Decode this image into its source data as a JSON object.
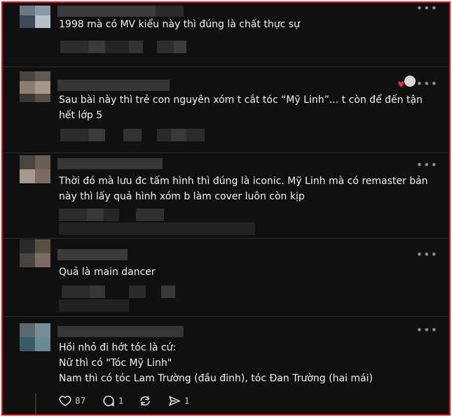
{
  "posts": [
    {
      "text": "1998 mà có MV kiểu này thì đúng là chất thực sự"
    },
    {
      "text": "Sau bài này thì trẻ con nguyên xóm t cắt tóc “Mỹ Linh”... t còn để đến tận hết lớp 5"
    },
    {
      "text": "Thời đó mà lưu đc tấm hình thì đúng là iconic. Mỹ Linh mà có remaster bản này thì lấy quả hình xóm b làm cover luôn còn kịp"
    },
    {
      "text": "Quả là main dancer"
    },
    {
      "lines": [
        "Hồi nhỏ đi hớt tóc là cứ:",
        "Nữ thì có \"Tóc Mỹ Linh\"",
        "Nam thì có tóc Lam Trường (đầu đinh), tóc Đan Trường (hai mái)"
      ]
    }
  ],
  "actions": {
    "likes": "87",
    "replies": "1",
    "shares": "1"
  },
  "icons": [
    "heart-icon",
    "comment-icon",
    "repost-icon",
    "share-icon",
    "more-icon"
  ],
  "colors": {
    "background": "#101010",
    "text": "#f3f3f3",
    "frame": "#e0101a"
  }
}
